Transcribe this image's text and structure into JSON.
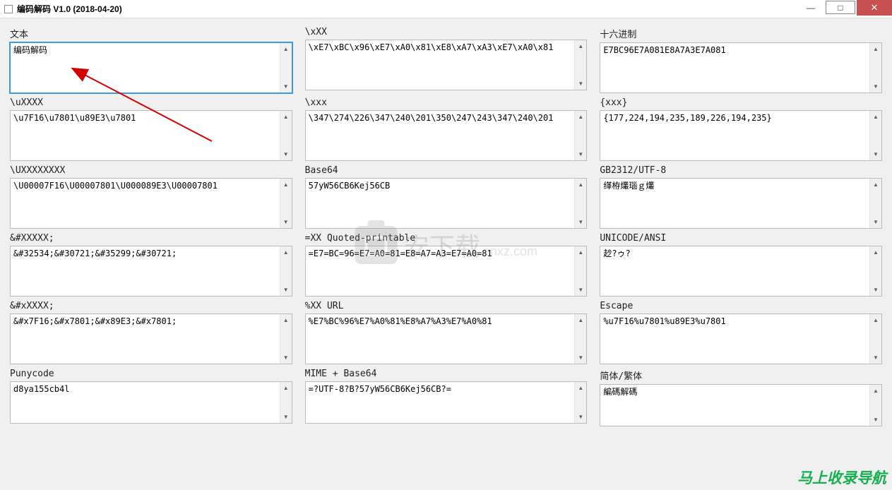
{
  "window": {
    "title": "编码解码 V1.0  (2018-04-20)"
  },
  "panels": {
    "text": {
      "label": "文本",
      "value": "编码解码"
    },
    "xhex": {
      "label": "\\xXX",
      "value": "\\xE7\\xBC\\x96\\xE7\\xA0\\x81\\xE8\\xA7\\xA3\\xE7\\xA0\\x81"
    },
    "hex16": {
      "label": "十六进制",
      "value": "E7BC96E7A081E8A7A3E7A081"
    },
    "u4": {
      "label": "\\uXXXX",
      "value": "\\u7F16\\u7801\\u89E3\\u7801"
    },
    "octal": {
      "label": "\\xxx",
      "value": "\\347\\274\\226\\347\\240\\201\\350\\247\\243\\347\\240\\201"
    },
    "bytes": {
      "label": "{xxx}",
      "value": "{177,224,194,235,189,226,194,235}"
    },
    "u8": {
      "label": "\\UXXXXXXXX",
      "value": "\\U00007F16\\U00007801\\U000089E3\\U00007801"
    },
    "base64": {
      "label": "Base64",
      "value": "57yW56CB6Kej56CB"
    },
    "gb2312": {
      "label": "GB2312/UTF-8",
      "value": "缂栫爜瑙ｇ爜"
    },
    "entdec": {
      "label": "&#XXXXX;",
      "value": "&#32534;&#30721;&#35299;&#30721;"
    },
    "qp": {
      "label": "=XX   Quoted-printable",
      "value": "=E7=BC=96=E7=A0=81=E8=A7=A3=E7=A0=81"
    },
    "unicode": {
      "label": "UNICODE/ANSI",
      "value": "赻?ゥ?"
    },
    "enthex": {
      "label": "&#xXXXX;",
      "value": "&#x7F16;&#x7801;&#x89E3;&#x7801;"
    },
    "url": {
      "label": "%XX   URL",
      "value": "%E7%BC%96%E7%A0%81%E8%A7%A3%E7%A0%81"
    },
    "escape": {
      "label": "Escape",
      "value": "%u7F16%u7801%u89E3%u7801"
    },
    "puny": {
      "label": "Punycode",
      "value": "d8ya155cb4l"
    },
    "mime": {
      "label": "MIME + Base64",
      "value": "=?UTF-8?B?57yW56CB6Kej56CB?="
    },
    "trad": {
      "label": "简体/繁体",
      "value": "編碼解碼"
    }
  },
  "watermark": {
    "text": "安下载",
    "domain": "anxz.com"
  },
  "footer": "马上收录导航"
}
